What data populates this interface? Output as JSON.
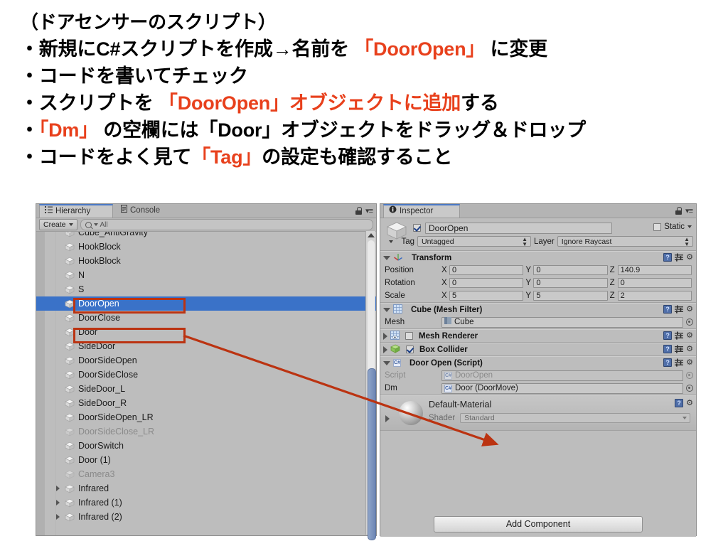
{
  "slide": {
    "lines": [
      [
        {
          "t": "（ドアセンサーのスクリプト）",
          "c": "black"
        }
      ],
      [
        {
          "t": "・新規にC#スクリプトを作成→名前を ",
          "c": "black"
        },
        {
          "t": "「DoorOpen」",
          "c": "red"
        },
        {
          "t": " に変更",
          "c": "black"
        }
      ],
      [
        {
          "t": "・コードを書いてチェック",
          "c": "black"
        }
      ],
      [
        {
          "t": "・スクリプトを ",
          "c": "black"
        },
        {
          "t": "「DoorOpen」オブジェクトに追加",
          "c": "red"
        },
        {
          "t": "する",
          "c": "black"
        }
      ],
      [
        {
          "t": "・",
          "c": "black"
        },
        {
          "t": "「Dm」",
          "c": "red"
        },
        {
          "t": " の空欄には「Door」オブジェクトをドラッグ＆ドロップ",
          "c": "black"
        }
      ],
      [
        {
          "t": "・コードをよく見て",
          "c": "black"
        },
        {
          "t": "「Tag」",
          "c": "red"
        },
        {
          "t": "の設定も確認すること",
          "c": "black"
        }
      ]
    ],
    "accent_red": "#e8401c",
    "annotation_red": "#bb3311"
  },
  "hierarchy": {
    "tabs": [
      {
        "label": "Hierarchy",
        "icon": "hierarchy-icon",
        "active": true
      },
      {
        "label": "Console",
        "icon": "console-icon",
        "active": false
      }
    ],
    "toolbar": {
      "create_label": "Create",
      "search_placeholder": "All",
      "search_value": "All"
    },
    "items": [
      {
        "label": "Cube_AntiGravity",
        "selected": false,
        "dim": false,
        "foldout": false,
        "clipped": true
      },
      {
        "label": "HookBlock",
        "selected": false,
        "dim": false,
        "foldout": false
      },
      {
        "label": "HookBlock",
        "selected": false,
        "dim": false,
        "foldout": false
      },
      {
        "label": "N",
        "selected": false,
        "dim": false,
        "foldout": false
      },
      {
        "label": "S",
        "selected": false,
        "dim": false,
        "foldout": false
      },
      {
        "label": "DoorOpen",
        "selected": true,
        "dim": false,
        "foldout": false
      },
      {
        "label": "DoorClose",
        "selected": false,
        "dim": false,
        "foldout": false
      },
      {
        "label": "Door",
        "selected": false,
        "dim": false,
        "foldout": false
      },
      {
        "label": "SideDoor",
        "selected": false,
        "dim": false,
        "foldout": false
      },
      {
        "label": "DoorSideOpen",
        "selected": false,
        "dim": false,
        "foldout": false
      },
      {
        "label": "DoorSideClose",
        "selected": false,
        "dim": false,
        "foldout": false
      },
      {
        "label": "SideDoor_L",
        "selected": false,
        "dim": false,
        "foldout": false
      },
      {
        "label": "SideDoor_R",
        "selected": false,
        "dim": false,
        "foldout": false
      },
      {
        "label": "DoorSideOpen_LR",
        "selected": false,
        "dim": false,
        "foldout": false
      },
      {
        "label": "DoorSideClose_LR",
        "selected": false,
        "dim": true,
        "foldout": false
      },
      {
        "label": "DoorSwitch",
        "selected": false,
        "dim": false,
        "foldout": false
      },
      {
        "label": "Door (1)",
        "selected": false,
        "dim": false,
        "foldout": false
      },
      {
        "label": "Camera3",
        "selected": false,
        "dim": true,
        "foldout": false
      },
      {
        "label": "Infrared",
        "selected": false,
        "dim": false,
        "foldout": true
      },
      {
        "label": "Infrared (1)",
        "selected": false,
        "dim": false,
        "foldout": true
      },
      {
        "label": "Infrared (2)",
        "selected": false,
        "dim": false,
        "foldout": true
      }
    ],
    "selection_color": "#3a72c8"
  },
  "inspector": {
    "tab": {
      "label": "Inspector",
      "icon": "info-icon"
    },
    "object": {
      "name": "DoorOpen",
      "enabled": true,
      "static_label": "Static",
      "static_checked": false,
      "tag_label": "Tag",
      "tag_value": "Untagged",
      "layer_label": "Layer",
      "layer_value": "Ignore Raycast"
    },
    "components": [
      {
        "name": "Transform",
        "icon": "transform-icon",
        "expanded": true,
        "rows": [
          {
            "label": "Position",
            "x": "0",
            "y": "0",
            "z": "140.9"
          },
          {
            "label": "Rotation",
            "x": "0",
            "y": "0",
            "z": "0"
          },
          {
            "label": "Scale",
            "x": "5",
            "y": "5",
            "z": "2"
          }
        ]
      },
      {
        "name": "Cube (Mesh Filter)",
        "icon": "mesh-filter-icon",
        "expanded": true,
        "mesh_label": "Mesh",
        "mesh_value": "Cube"
      },
      {
        "name": "Mesh Renderer",
        "icon": "mesh-renderer-icon",
        "expanded": false,
        "enabled": false
      },
      {
        "name": "Box Collider",
        "icon": "box-collider-icon",
        "expanded": false,
        "enabled": true
      },
      {
        "name": "Door Open (Script)",
        "icon": "csharp-script-icon",
        "expanded": true,
        "script_label": "Script",
        "script_value": "DoorOpen",
        "dm_label": "Dm",
        "dm_value": "Door (DoorMove)"
      }
    ],
    "material": {
      "name": "Default-Material",
      "shader_label": "Shader",
      "shader_value": "Standard"
    },
    "add_component_label": "Add Component"
  }
}
